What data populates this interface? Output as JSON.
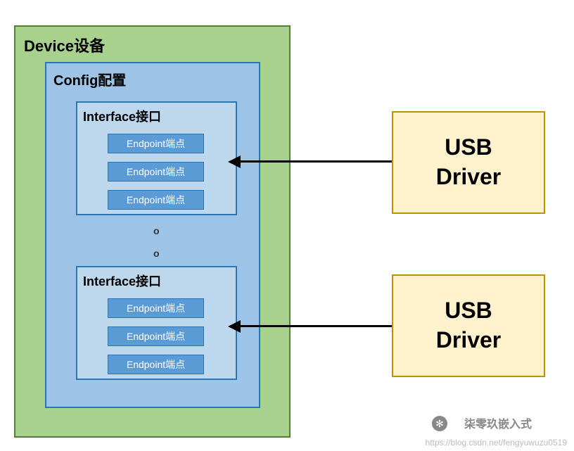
{
  "device": {
    "title": "Device设备"
  },
  "config": {
    "title": "Config配置"
  },
  "interfaces": [
    {
      "title": "Interface接口",
      "endpoints": [
        "Endpoint端点",
        "Endpoint端点",
        "Endpoint端点"
      ]
    },
    {
      "title": "Interface接口",
      "endpoints": [
        "Endpoint端点",
        "Endpoint端点",
        "Endpoint端点"
      ]
    }
  ],
  "ellipsis": "o",
  "drivers": [
    {
      "line1": "USB",
      "line2": "Driver"
    },
    {
      "line1": "USB",
      "line2": "Driver"
    }
  ],
  "watermark": {
    "label": "柒零玖嵌入式",
    "url": "https://blog.csdn.net/fengyuwuzu0519"
  }
}
